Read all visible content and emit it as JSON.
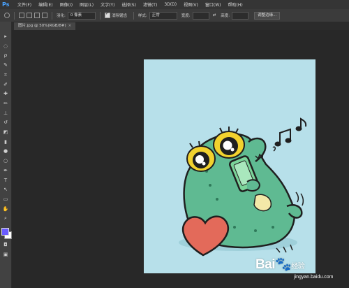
{
  "app": {
    "logo": "Ps"
  },
  "menu": [
    "文件(F)",
    "编辑(E)",
    "图像(I)",
    "图层(L)",
    "文字(Y)",
    "选择(S)",
    "滤镜(T)",
    "3D(D)",
    "视图(V)",
    "窗口(W)",
    "帮助(H)"
  ],
  "options": {
    "feather_label": "羽化:",
    "feather_value": "0 像素",
    "antialias_label": "消除锯齿",
    "style_label": "样式:",
    "style_value": "正常",
    "width_label": "宽度:",
    "height_label": "高度:",
    "refine_edge_button": "调整边缘..."
  },
  "document": {
    "tab_title": "图片.jpg @ 50%(RGB/8#)",
    "close_label": "×"
  },
  "colors": {
    "foreground": "#6a5cff",
    "background": "#ffffff",
    "canvas_background": "#b7e0ea",
    "workspace": "#282828"
  },
  "tools": [
    "move-tool-icon",
    "marquee-tool-icon",
    "lasso-tool-icon",
    "quick-select-tool-icon",
    "crop-tool-icon",
    "eyedropper-tool-icon",
    "healing-brush-tool-icon",
    "brush-tool-icon",
    "clone-stamp-tool-icon",
    "history-brush-tool-icon",
    "eraser-tool-icon",
    "gradient-tool-icon",
    "blur-tool-icon",
    "dodge-tool-icon",
    "pen-tool-icon",
    "type-tool-icon",
    "path-select-tool-icon",
    "shape-tool-icon",
    "hand-tool-icon",
    "zoom-tool-icon"
  ],
  "tool_glyphs": [
    "▸",
    "◌",
    "ρ",
    "✎",
    "⌗",
    "✐",
    "✚",
    "✏",
    "⊥",
    "↺",
    "◩",
    "▮",
    "●",
    "○",
    "✒",
    "T",
    "↖",
    "▭",
    "✋",
    "⌕"
  ],
  "watermark": {
    "brand": "Bai",
    "brand_suffix": "经验",
    "url": "jingyan.baidu.com"
  }
}
